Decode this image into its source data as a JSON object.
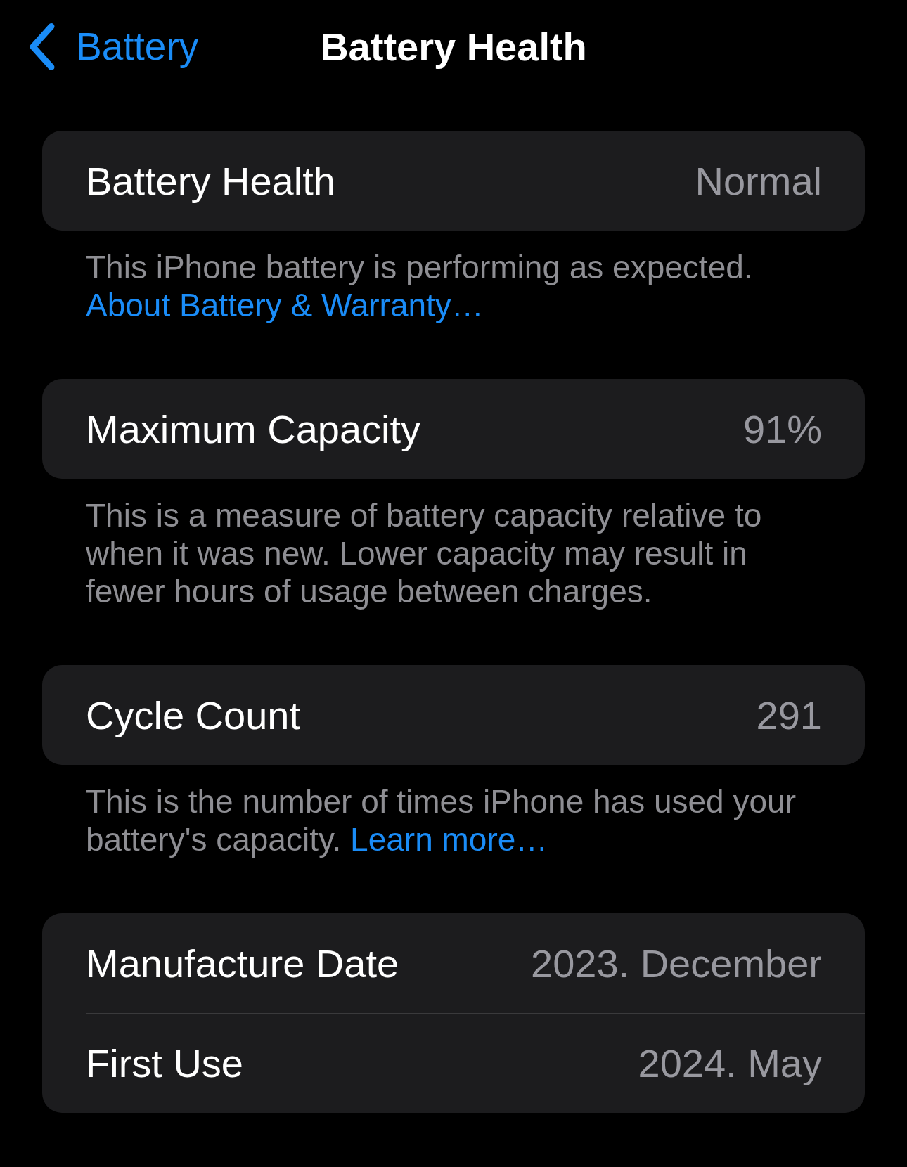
{
  "nav": {
    "back_label": "Battery",
    "title": "Battery Health"
  },
  "sections": [
    {
      "rows": [
        {
          "label": "Battery Health",
          "value": "Normal"
        }
      ],
      "footer": {
        "text": "This iPhone battery is performing as expected.",
        "link": "About Battery & Warranty…"
      }
    },
    {
      "rows": [
        {
          "label": "Maximum Capacity",
          "value": "91%"
        }
      ],
      "footer": {
        "text": "This is a measure of battery capacity relative to when it was new. Lower capacity may result in fewer hours of usage between charges."
      }
    },
    {
      "rows": [
        {
          "label": "Cycle Count",
          "value": "291"
        }
      ],
      "footer": {
        "text": "This is the number of times iPhone has used your battery's capacity.",
        "link": "Learn more…"
      }
    },
    {
      "rows": [
        {
          "label": "Manufacture Date",
          "value": "2023. December"
        },
        {
          "label": "First Use",
          "value": "2024. May"
        }
      ]
    }
  ]
}
